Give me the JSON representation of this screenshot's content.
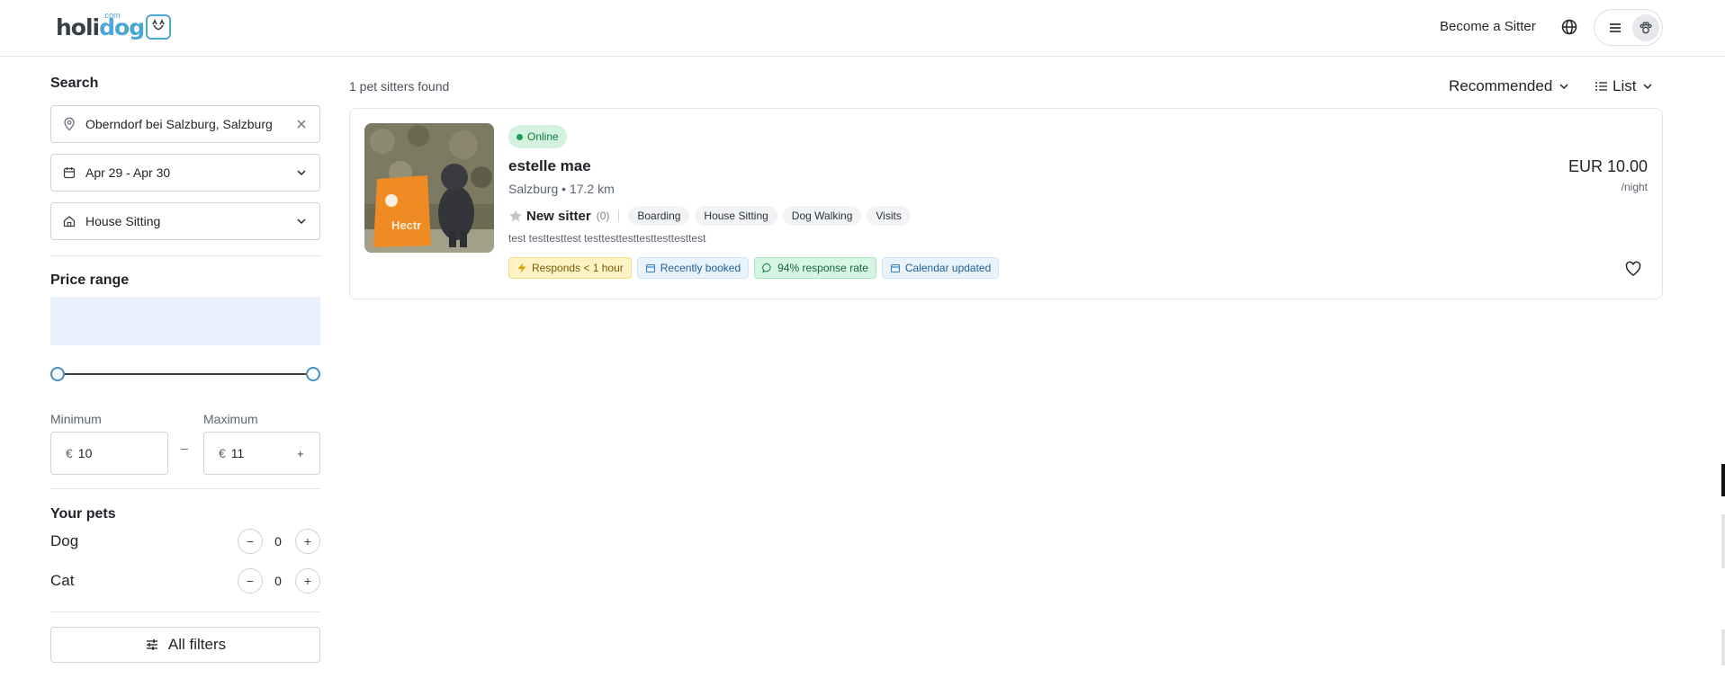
{
  "header": {
    "logo_text_a": "holi",
    "logo_text_b": "dog",
    "logo_com": ".com",
    "become_sitter": "Become a Sitter"
  },
  "search": {
    "heading": "Search",
    "location": "Oberndorf bei Salzburg, Salzburg",
    "dates": "Apr 29 - Apr 30",
    "service": "House Sitting"
  },
  "price": {
    "heading": "Price range",
    "min_label": "Minimum",
    "max_label": "Maximum",
    "currency": "€",
    "min_value": "10",
    "max_value": "11",
    "dash": "–",
    "plus": "+"
  },
  "pets": {
    "heading": "Your pets",
    "items": [
      {
        "label": "Dog",
        "count": "0"
      },
      {
        "label": "Cat",
        "count": "0"
      }
    ],
    "minus": "−",
    "plus": "+"
  },
  "filters": {
    "label": "All filters"
  },
  "results": {
    "count_text": "1 pet sitters found",
    "sort_label": "Recommended",
    "view_label": "List"
  },
  "sitter": {
    "status": "Online",
    "name": "estelle mae",
    "city": "Salzburg",
    "bullet": "•",
    "distance": "17.2 km",
    "rating_label": "New sitter",
    "rating_count": "(0)",
    "services": [
      "Boarding",
      "House Sitting",
      "Dog Walking",
      "Visits"
    ],
    "description": "test testtesttest testtesttesttesttesttesttest",
    "badges": [
      {
        "label": "Responds < 1 hour",
        "style": "yellow",
        "icon": "bolt-icon"
      },
      {
        "label": "Recently booked",
        "style": "blue",
        "icon": "calendar-icon"
      },
      {
        "label": "94% response rate",
        "style": "green",
        "icon": "chat-icon"
      },
      {
        "label": "Calendar updated",
        "style": "blue",
        "icon": "calendar-icon"
      }
    ],
    "price": "EUR 10.00",
    "per": "/night"
  },
  "colors": {
    "accent": "#4aa6d6",
    "online_bg": "#d3f3df",
    "histogram_bg": "#e9f1fc"
  }
}
